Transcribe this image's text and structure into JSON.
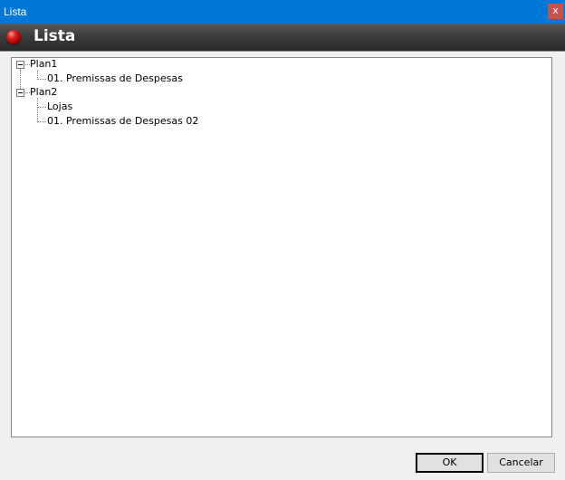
{
  "window": {
    "title": "Lista",
    "close_glyph": "x"
  },
  "header": {
    "title": "Lista",
    "icon": "red-ball-icon"
  },
  "tree": {
    "nodes": [
      {
        "label": "Plan1",
        "expanded": true,
        "children": [
          {
            "label": "01. Premissas de Despesas"
          }
        ]
      },
      {
        "label": "Plan2",
        "expanded": true,
        "children": [
          {
            "label": "Lojas"
          },
          {
            "label": "01. Premissas de Despesas 02"
          }
        ]
      }
    ]
  },
  "buttons": {
    "ok_label": "OK",
    "cancel_label": "Cancelar"
  },
  "colors": {
    "titlebar": "#0078d7",
    "close": "#c75050",
    "header_dark": "#2a2a2a"
  }
}
